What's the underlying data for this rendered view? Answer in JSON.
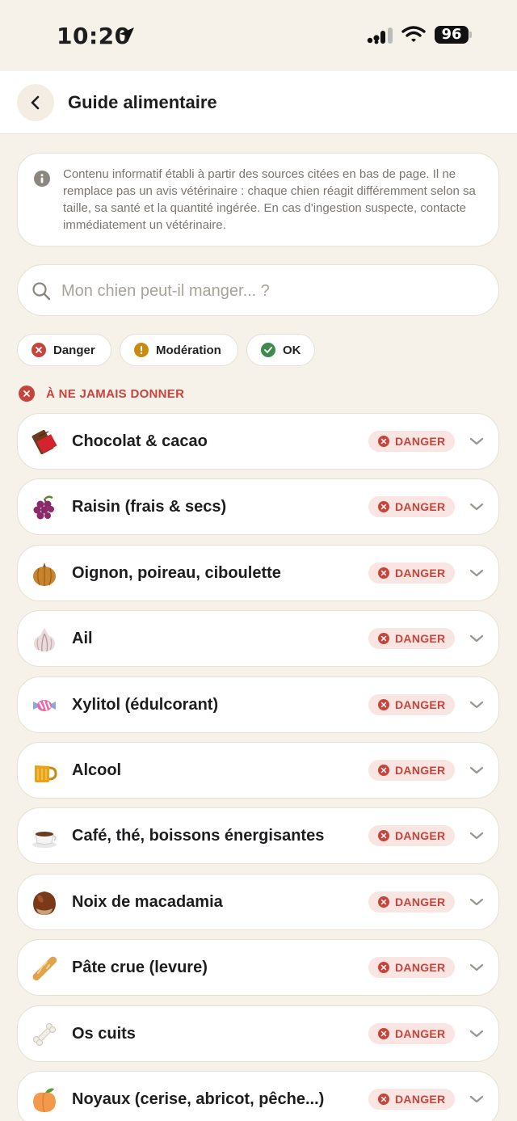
{
  "status_bar": {
    "time": "10:20",
    "battery": "96"
  },
  "header": {
    "title": "Guide alimentaire"
  },
  "info": {
    "text": "Contenu informatif établi à partir des sources citées en bas de page. Il ne remplace pas un avis vétérinaire : chaque chien réagit différemment selon sa taille, sa santé et la quantité ingérée. En cas d'ingestion suspecte, contacte immédiatement un vétérinaire."
  },
  "search": {
    "placeholder": "Mon chien peut-il manger... ?"
  },
  "filters": [
    {
      "label": "Danger",
      "color": "#c6443c"
    },
    {
      "label": "Modération",
      "color": "#c98a12"
    },
    {
      "label": "OK",
      "color": "#3f8a4e"
    }
  ],
  "section": {
    "title": "À NE JAMAIS DONNER",
    "color": "#c6443c"
  },
  "items": [
    {
      "label": "Chocolat & cacao",
      "badge": "DANGER",
      "icon": "chocolate-icon"
    },
    {
      "label": "Raisin (frais & secs)",
      "badge": "DANGER",
      "icon": "grapes-icon"
    },
    {
      "label": "Oignon, poireau, ciboulette",
      "badge": "DANGER",
      "icon": "onion-icon"
    },
    {
      "label": "Ail",
      "badge": "DANGER",
      "icon": "garlic-icon"
    },
    {
      "label": "Xylitol (édulcorant)",
      "badge": "DANGER",
      "icon": "candy-icon"
    },
    {
      "label": "Alcool",
      "badge": "DANGER",
      "icon": "beer-icon"
    },
    {
      "label": "Café, thé, boissons énergisantes",
      "badge": "DANGER",
      "icon": "coffee-icon"
    },
    {
      "label": "Noix de macadamia",
      "badge": "DANGER",
      "icon": "chestnut-icon"
    },
    {
      "label": "Pâte crue (levure)",
      "badge": "DANGER",
      "icon": "baguette-icon"
    },
    {
      "label": "Os cuits",
      "badge": "DANGER",
      "icon": "bone-icon"
    },
    {
      "label": "Noyaux (cerise, abricot, pêche...)",
      "badge": "DANGER",
      "icon": "peach-icon"
    }
  ]
}
